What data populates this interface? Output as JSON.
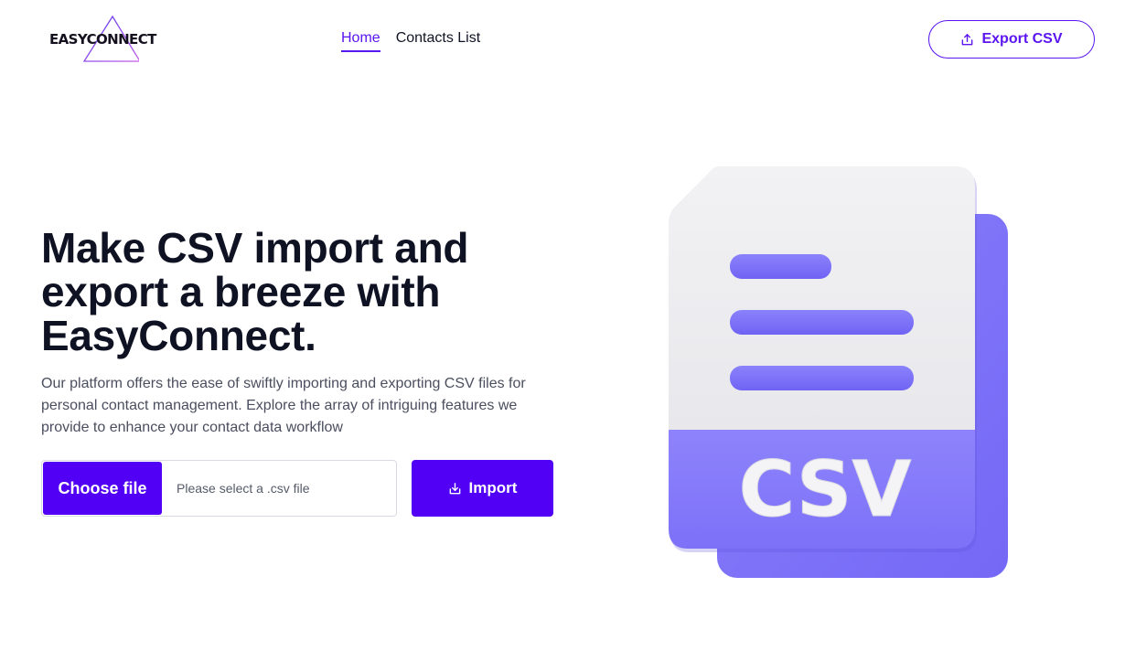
{
  "header": {
    "logo_text": "EASYCONNECT",
    "nav": [
      {
        "label": "Home",
        "active": true
      },
      {
        "label": "Contacts List",
        "active": false
      }
    ],
    "export_label": "Export CSV"
  },
  "hero": {
    "title_line1": "Make CSV import and",
    "title_line2": "export a breeze with",
    "title_brand": "EasyConnect.",
    "description": "Our platform offers the ease of swiftly importing and exporting CSV files for personal contact management. Explore the array of intriguing features we provide to enhance your contact data workflow",
    "choose_file_label": "Choose file",
    "file_placeholder": "Please select a .csv file",
    "import_label": "Import"
  },
  "illustration": {
    "badge_text": "CSV"
  },
  "colors": {
    "accent": "#5100f5",
    "nav_active": "#5b16f0",
    "doc_purple": "#7f75fb"
  },
  "icons": [
    "logo-triangle-icon",
    "export-icon",
    "import-icon",
    "csv-file-icon"
  ]
}
